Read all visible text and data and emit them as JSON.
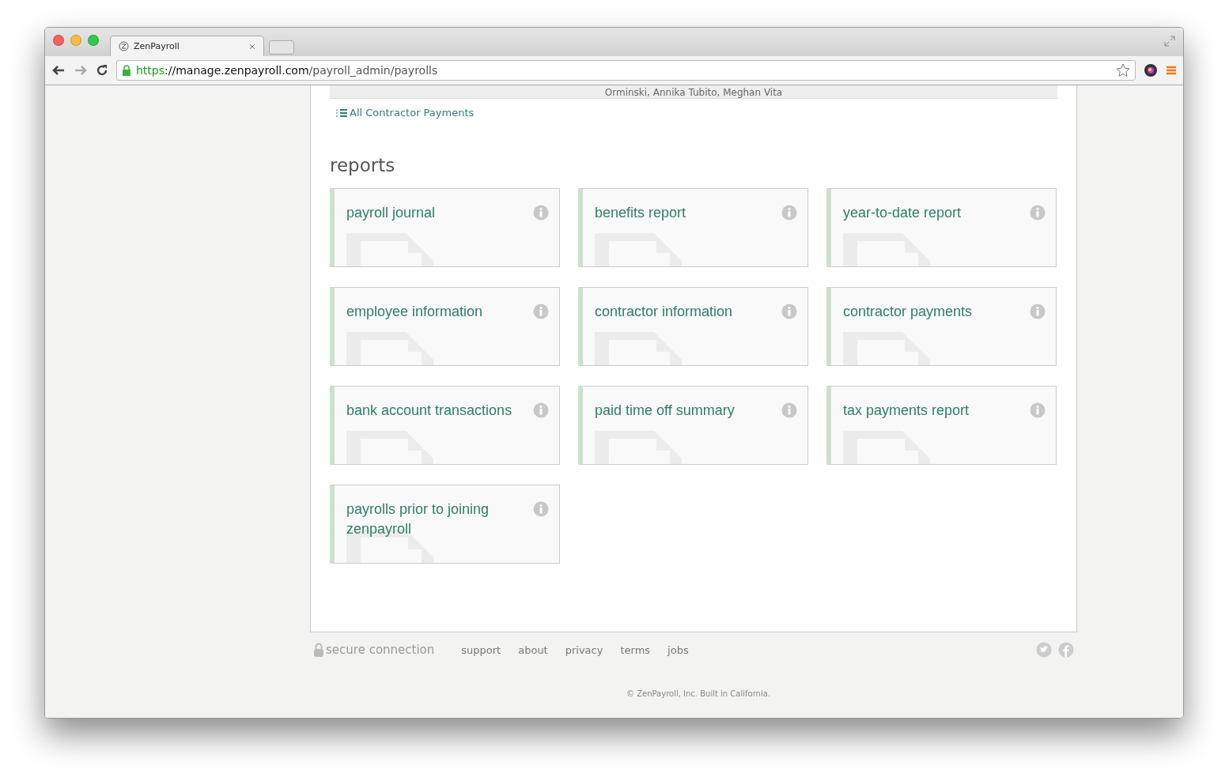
{
  "browser": {
    "tab_title": "ZenPayroll",
    "url_scheme": "https",
    "url_host": "://manage.zenpayroll.com",
    "url_path": "/payroll_admin/payrolls"
  },
  "top_strip": {
    "names": "Orminski, Annika Tubito, Meghan Vita"
  },
  "contractor_link": "All Contractor Payments",
  "reports": {
    "heading": "reports",
    "items": [
      {
        "title": "payroll journal"
      },
      {
        "title": "benefits report"
      },
      {
        "title": "year-to-date report"
      },
      {
        "title": "employee information"
      },
      {
        "title": "contractor information"
      },
      {
        "title": "contractor payments"
      },
      {
        "title": "bank account transactions"
      },
      {
        "title": "paid time off summary"
      },
      {
        "title": "tax payments report"
      },
      {
        "title": "payrolls prior to joining zenpayroll"
      }
    ]
  },
  "footer": {
    "secure": "secure connection",
    "links": [
      "support",
      "about",
      "privacy",
      "terms",
      "jobs"
    ],
    "copyright": "© ZenPayroll, Inc. Built in California."
  }
}
